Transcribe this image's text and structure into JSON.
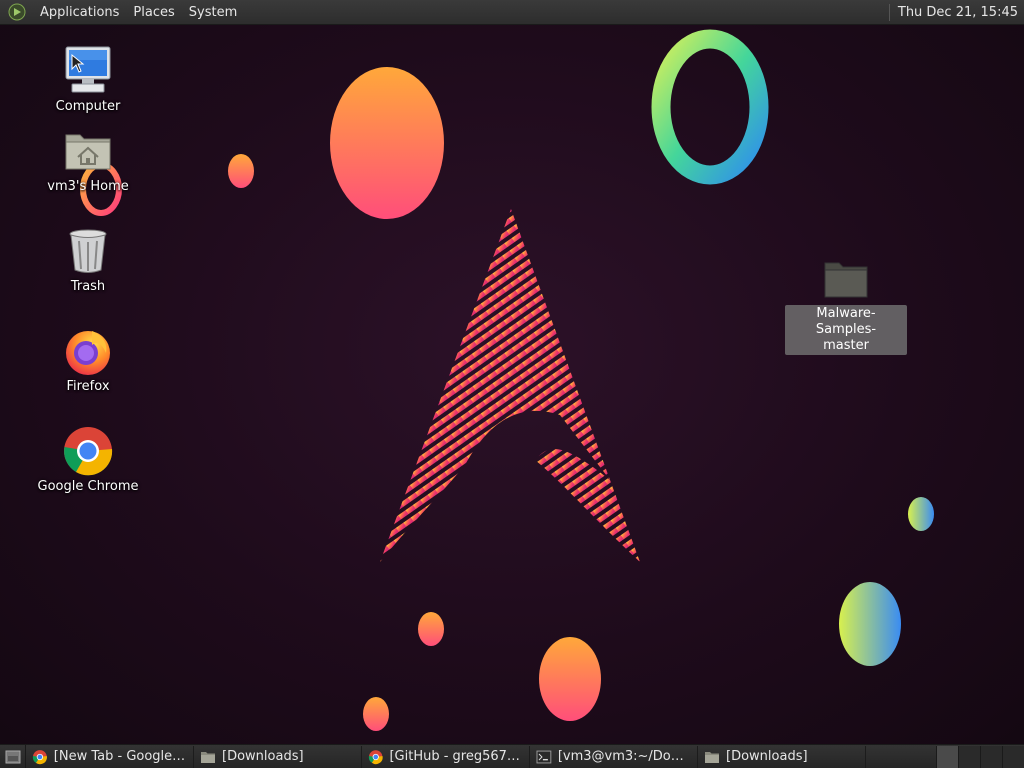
{
  "top_panel": {
    "menus": [
      "Applications",
      "Places",
      "System"
    ],
    "clock": "Thu Dec 21, 15:45"
  },
  "desktop_icons": [
    {
      "name": "computer",
      "label": "Computer",
      "icon": "computer-monitor-icon"
    },
    {
      "name": "home",
      "label": "vm3's Home",
      "icon": "home-folder-icon"
    },
    {
      "name": "trash",
      "label": "Trash",
      "icon": "trash-can-icon"
    },
    {
      "name": "firefox",
      "label": "Firefox",
      "icon": "firefox-icon"
    },
    {
      "name": "chrome",
      "label": "Google Chrome",
      "icon": "chrome-icon"
    }
  ],
  "selected_folder": {
    "label_line1": "Malware-Samples-",
    "label_line2": "master",
    "icon": "folder-icon"
  },
  "taskbar": {
    "tasks": [
      {
        "label": "[New Tab - Google ...",
        "icon": "chrome-icon"
      },
      {
        "label": "[Downloads]",
        "icon": "folder-icon"
      },
      {
        "label": "[GitHub - greg5678...",
        "icon": "chrome-icon"
      },
      {
        "label": "[vm3@vm3:~/Dow...",
        "icon": "terminal-icon"
      },
      {
        "label": "[Downloads]",
        "icon": "folder-icon"
      }
    ],
    "workspaces": 4,
    "active_workspace": 1
  },
  "colors": {
    "panel_bg": "#2d2d2d",
    "desktop_bg": "#1e0b1b",
    "accent_pink": "#e0357a",
    "accent_orange": "#ff9a3c"
  }
}
